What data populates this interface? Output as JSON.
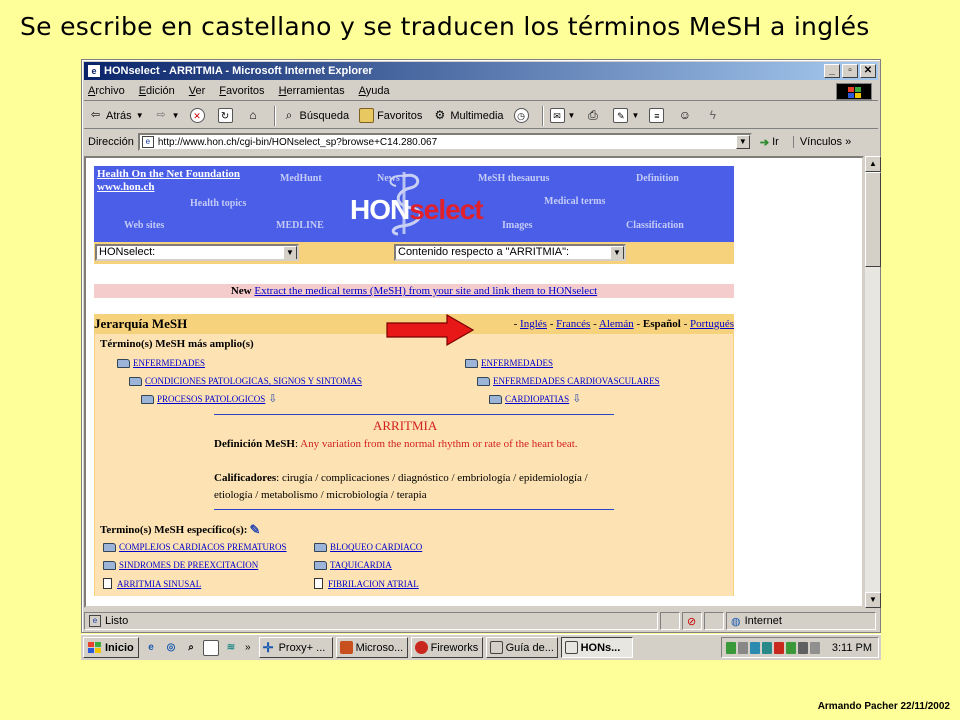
{
  "slide": {
    "title": "Se escribe en castellano y se traducen los términos MeSH a inglés",
    "footer": "Armando Pacher 22/11/2002"
  },
  "window": {
    "title": "HONselect - ARRITMIA - Microsoft Internet Explorer",
    "menu": [
      "Archivo",
      "Edición",
      "Ver",
      "Favoritos",
      "Herramientas",
      "Ayuda"
    ],
    "toolbar": {
      "back": "Atrás",
      "search": "Búsqueda",
      "favorites": "Favoritos",
      "multimedia": "Multimedia"
    },
    "address_label": "Dirección",
    "address": "http://www.hon.ch/cgi-bin/HONselect_sp?browse+C14.280.067",
    "go": "Ir",
    "links": "Vínculos"
  },
  "banner": {
    "foundation": "Health On the Net Foundation",
    "site": "www.hon.ch",
    "links": [
      "MedHunt",
      "News",
      "MeSH thesaurus",
      "Definition",
      "Health topics",
      "Medical terms",
      "Web sites",
      "MEDLINE",
      "Images",
      "Classification"
    ],
    "logo_a": "HON",
    "logo_b": "select",
    "select_left": "HONselect:",
    "select_right": "Contenido respecto a \"ARRITMIA\":"
  },
  "newbar": {
    "new": "New",
    "link": "Extract the medical terms (MeSH) from your site and link them to HONselect"
  },
  "hierarchy": {
    "title": "Jerarquía MeSH",
    "dash": "-",
    "langs": [
      "Inglés",
      "Francés",
      "Alemán",
      "Español",
      "Portugués"
    ],
    "current": "Español",
    "broader_title": "Término(s) MeSH más amplio(s)",
    "left_tree": [
      "ENFERMEDADES",
      "CONDICIONES PATOLOGICAS, SIGNOS Y SINTOMAS",
      "PROCESOS PATOLOGICOS"
    ],
    "right_tree": [
      "ENFERMEDADES",
      "ENFERMEDADES CARDIOVASCULARES",
      "CARDIOPATIAS"
    ],
    "term": "ARRITMIA",
    "def_label": "Definición MeSH",
    "def_text": "Any variation from the normal rhythm or rate of the heart beat.",
    "qual_label": "Calificadores",
    "qual_text": "cirugía / complicaciones / diagnóstico / embriología / epidemiología / etiología / metabolismo / microbiología / terapia",
    "narrower_title": "Termino(s) MeSH específico(s):",
    "narrower_left": [
      "COMPLEJOS CARDIACOS PREMATUROS",
      "SINDROMES DE PREEXCITACION",
      "ARRITMIA SINUSAL"
    ],
    "narrower_right": [
      "BLOQUEO CARDIACO",
      "TAQUICARDIA",
      "FIBRILACION ATRIAL"
    ]
  },
  "statusbar": {
    "status": "Listo",
    "zone": "Internet"
  },
  "taskbar": {
    "start": "Inicio",
    "tasks": [
      "Proxy+ ...",
      "Microso...",
      "Fireworks",
      "Guía de...",
      "HONs..."
    ],
    "clock": "3:11 PM"
  }
}
